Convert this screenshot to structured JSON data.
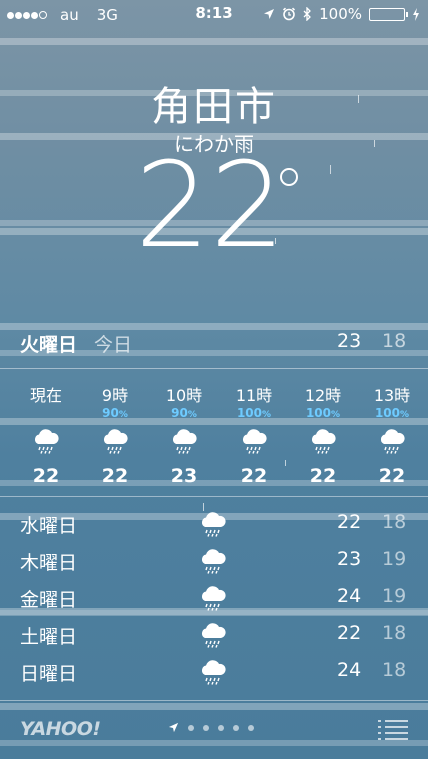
{
  "status_bar": {
    "carrier": "au",
    "network": "3G",
    "time": "8:13",
    "battery": "100%",
    "signal_bars_filled": 4,
    "signal_bars_total": 5
  },
  "weather": {
    "city": "角田市",
    "condition": "にわか雨",
    "temperature": "22",
    "today": {
      "day": "火曜日",
      "label": "今日",
      "high": "23",
      "low": "18"
    },
    "hourly": [
      {
        "time": "現在",
        "precip": "",
        "temp": "22",
        "icon": "rain-cloud-icon"
      },
      {
        "time": "9時",
        "precip": "90",
        "temp": "22",
        "icon": "rain-cloud-icon"
      },
      {
        "time": "10時",
        "precip": "90",
        "temp": "23",
        "icon": "rain-cloud-icon"
      },
      {
        "time": "11時",
        "precip": "100",
        "temp": "22",
        "icon": "rain-cloud-icon"
      },
      {
        "time": "12時",
        "precip": "100",
        "temp": "22",
        "icon": "rain-cloud-icon"
      },
      {
        "time": "13時",
        "precip": "100",
        "temp": "22",
        "icon": "rain-cloud-icon"
      }
    ],
    "daily": [
      {
        "day": "水曜日",
        "high": "22",
        "low": "18",
        "icon": "rain-cloud-icon"
      },
      {
        "day": "木曜日",
        "high": "23",
        "low": "19",
        "icon": "rain-cloud-icon"
      },
      {
        "day": "金曜日",
        "high": "24",
        "low": "19",
        "icon": "rain-cloud-icon"
      },
      {
        "day": "土曜日",
        "high": "22",
        "low": "18",
        "icon": "rain-cloud-icon"
      },
      {
        "day": "日曜日",
        "high": "24",
        "low": "18",
        "icon": "rain-cloud-icon"
      }
    ]
  },
  "footer": {
    "brand": "YAHOO!",
    "page_dots": 5
  },
  "colors": {
    "precip_blue": "#6ecbff",
    "battery_green": "#4cd964"
  }
}
